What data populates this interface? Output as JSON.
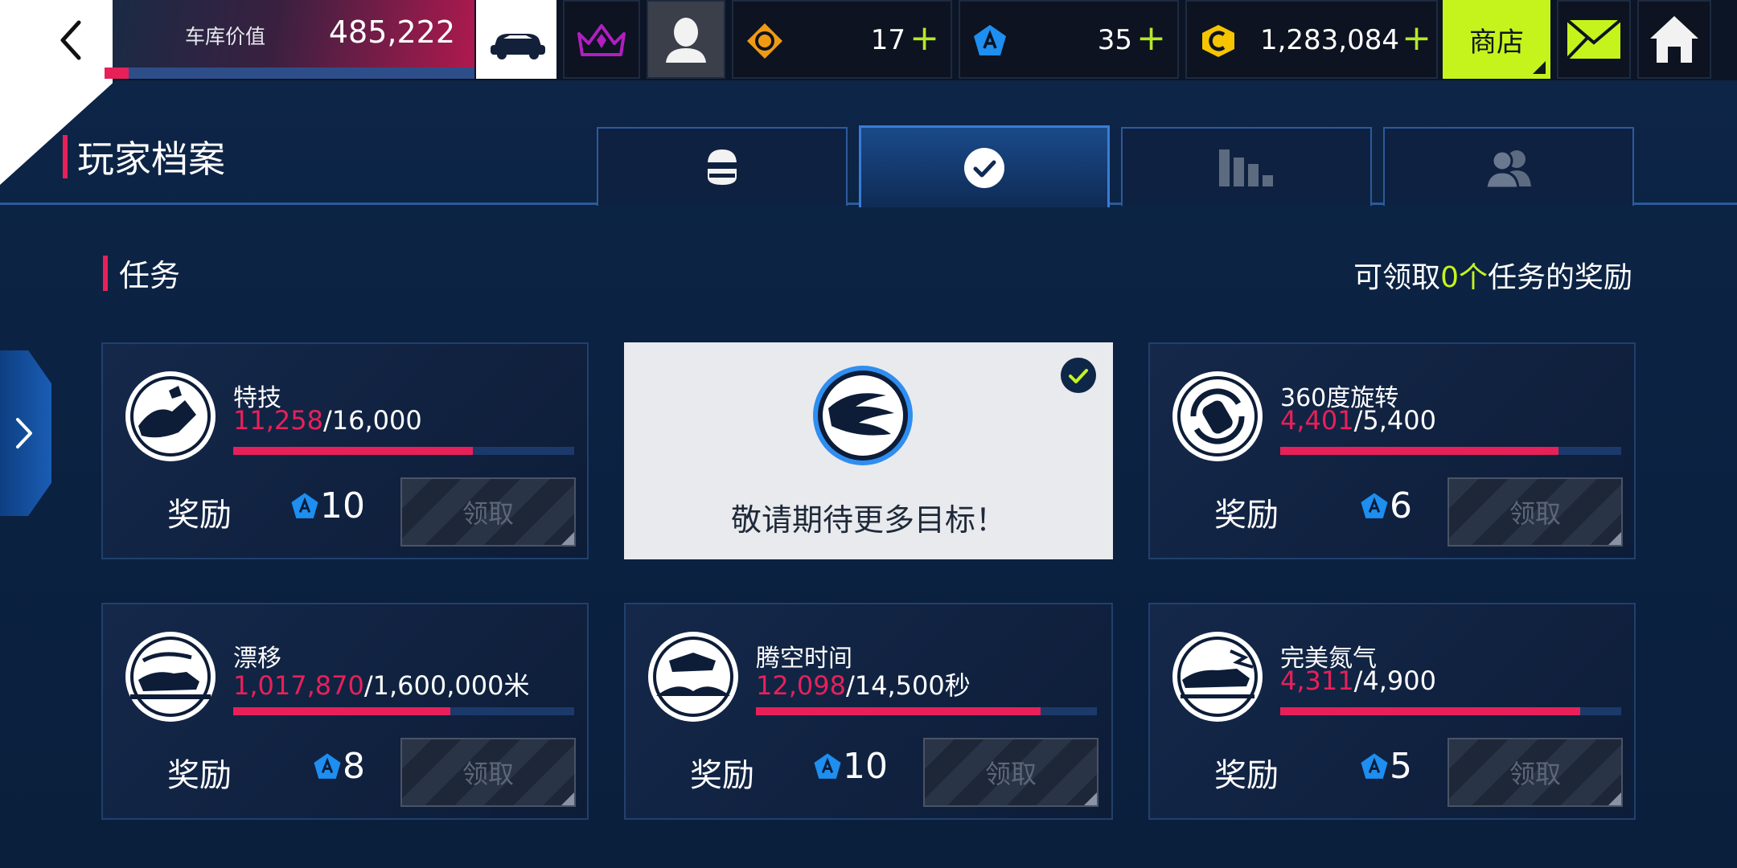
{
  "topbar": {
    "garage_label": "车库价值",
    "garage_value": "485,222",
    "garage_progress": 0.065,
    "tokens": "17",
    "blueprints": "35",
    "credits": "1,283,084",
    "plus": "+",
    "shop_label": "商店"
  },
  "header": {
    "title": "玩家档案",
    "tabs": [
      {
        "icon": "helmet-icon"
      },
      {
        "icon": "checkmark-icon",
        "active": true
      },
      {
        "icon": "bar-chart-icon"
      },
      {
        "icon": "friends-icon"
      }
    ]
  },
  "missions": {
    "title": "任务",
    "rewards_prefix": "可领取",
    "rewards_count": "0个",
    "rewards_suffix": "任务的奖励",
    "reward_label": "奖励",
    "claim_label": "领取",
    "coming_soon": "敬请期待更多目标！",
    "cards": [
      {
        "name": "特技",
        "current": "11,258",
        "target": "/16,000",
        "progress": 0.7036,
        "reward": "10",
        "icon": "stunt-emblem-icon"
      },
      {
        "name": "360度旋转",
        "current": "4,401",
        "target": "/5,400",
        "progress": 0.815,
        "reward": "6",
        "icon": "spin-360-emblem-icon"
      },
      {
        "name": "漂移",
        "current": "1,017,870",
        "target": "/1,600,000米",
        "progress": 0.636,
        "reward": "8",
        "icon": "drift-emblem-icon"
      },
      {
        "name": "腾空时间",
        "current": "12,098",
        "target": "/14,500秒",
        "progress": 0.834,
        "reward": "10",
        "icon": "airtime-emblem-icon"
      },
      {
        "name": "完美氮气",
        "current": "4,311",
        "target": "/4,900",
        "progress": 0.88,
        "reward": "5",
        "icon": "perfect-nitro-emblem-icon"
      }
    ]
  },
  "colors": {
    "accent_red": "#e8205a",
    "accent_lime": "#c5f41c",
    "blueprint_blue": "#1e8ef0",
    "token_orange": "#f09a14",
    "credit_yellow": "#f6c400"
  }
}
